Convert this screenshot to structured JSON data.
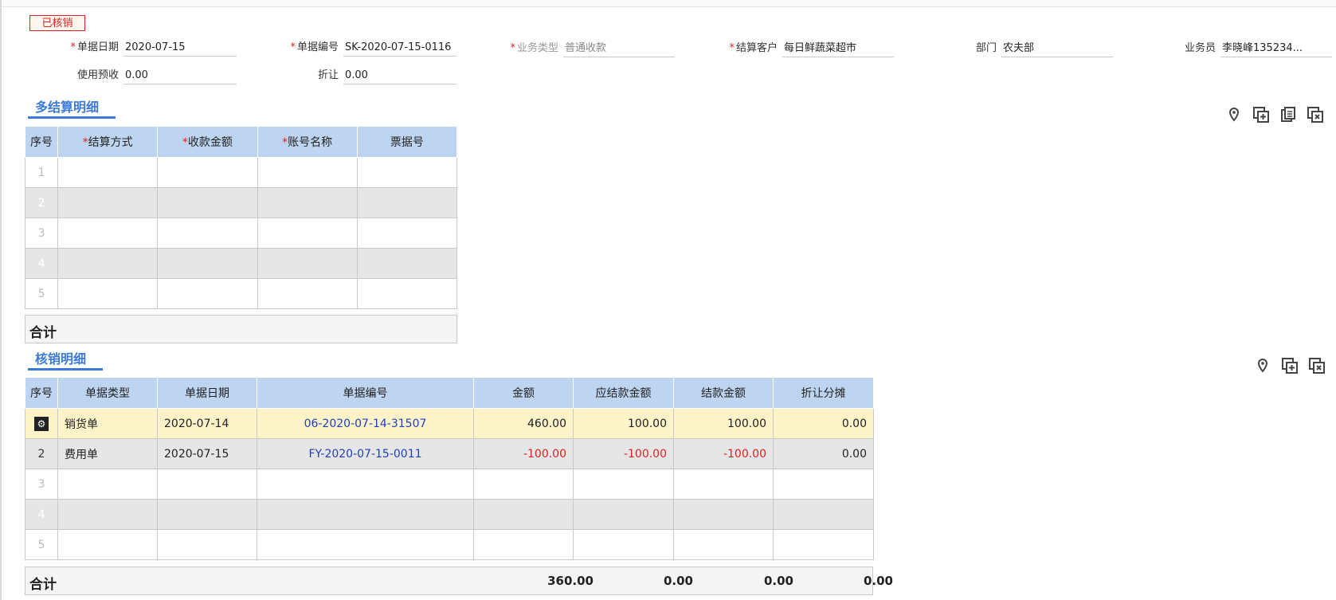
{
  "status_badge": "已核销",
  "header_fields": {
    "date": {
      "label": "单据日期",
      "value": "2020-07-15"
    },
    "bill_no": {
      "label": "单据编号",
      "value": "SK-2020-07-15-0116"
    },
    "biz_type": {
      "label": "业务类型",
      "value": "普通收款"
    },
    "customer": {
      "label": "结算客户",
      "value": "每日鲜蔬菜超市"
    },
    "department": {
      "label": "部门",
      "value": "农夫部"
    },
    "salesman": {
      "label": "业务员",
      "value": "李晓峰135234..."
    },
    "prepay": {
      "label": "使用预收",
      "value": "0.00"
    },
    "discount": {
      "label": "折让",
      "value": "0.00"
    }
  },
  "settlement": {
    "title": "多结算明细",
    "columns": [
      "序号",
      "结算方式",
      "收款金额",
      "账号名称",
      "票据号"
    ],
    "rows": [
      {
        "idx": "1"
      },
      {
        "idx": "2"
      },
      {
        "idx": "3"
      },
      {
        "idx": "4"
      },
      {
        "idx": "5"
      }
    ],
    "total_label": "合计"
  },
  "writeoff": {
    "title": "核销明细",
    "columns": [
      "序号",
      "单据类型",
      "单据日期",
      "单据编号",
      "金额",
      "应结款金额",
      "结款金额",
      "折让分摊"
    ],
    "rows": [
      {
        "idx": "",
        "type": "销货单",
        "date": "2020-07-14",
        "no": "06-2020-07-14-31507",
        "amount": "460.00",
        "due": "100.00",
        "paid": "100.00",
        "disc": "0.00"
      },
      {
        "idx": "2",
        "type": "费用单",
        "date": "2020-07-15",
        "no": "FY-2020-07-15-0011",
        "amount": "-100.00",
        "due": "-100.00",
        "paid": "-100.00",
        "disc": "0.00"
      },
      {
        "idx": "3"
      },
      {
        "idx": "4"
      },
      {
        "idx": "5"
      }
    ],
    "total_label": "合计",
    "totals": {
      "amount": "360.00",
      "due": "0.00",
      "paid": "0.00",
      "disc": "0.00"
    }
  },
  "toolbar_icons": {
    "settlement": [
      "location-pin-icon",
      "add-row-icon",
      "copy-row-icon",
      "delete-row-icon"
    ],
    "writeoff": [
      "location-pin-icon",
      "add-row-icon",
      "delete-row-icon"
    ]
  },
  "colors": {
    "accent": "#3a7ad8",
    "header_bg": "#bdd5f1",
    "selected_row": "#fdf3c9",
    "negative": "#e02020",
    "link": "#1f3fbf"
  }
}
